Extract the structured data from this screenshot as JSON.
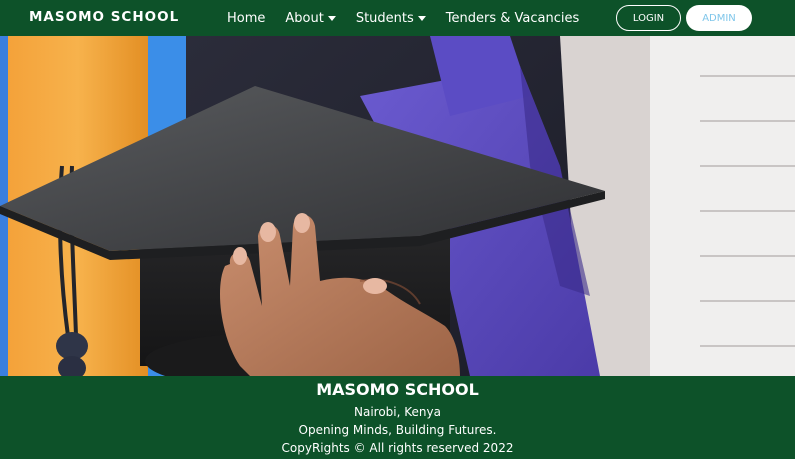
{
  "navbar": {
    "brand": "MASOMO SCHOOL",
    "links": [
      {
        "label": "Home"
      },
      {
        "label": "About"
      },
      {
        "label": "Students"
      },
      {
        "label": "Tenders & Vacancies"
      }
    ],
    "login_label": "LOGIN",
    "admin_label": "ADMIN"
  },
  "hero": {
    "image": "graduation-cap-in-hand"
  },
  "footer": {
    "title": "MASOMO SCHOOL",
    "location": "Nairobi, Kenya",
    "motto": "Opening Minds, Building Futures.",
    "copyright": "CopyRights © All rights reserved 2022"
  },
  "colors": {
    "primary_green": "#0d5229",
    "admin_text": "#7fc6ea",
    "white": "#ffffff"
  }
}
